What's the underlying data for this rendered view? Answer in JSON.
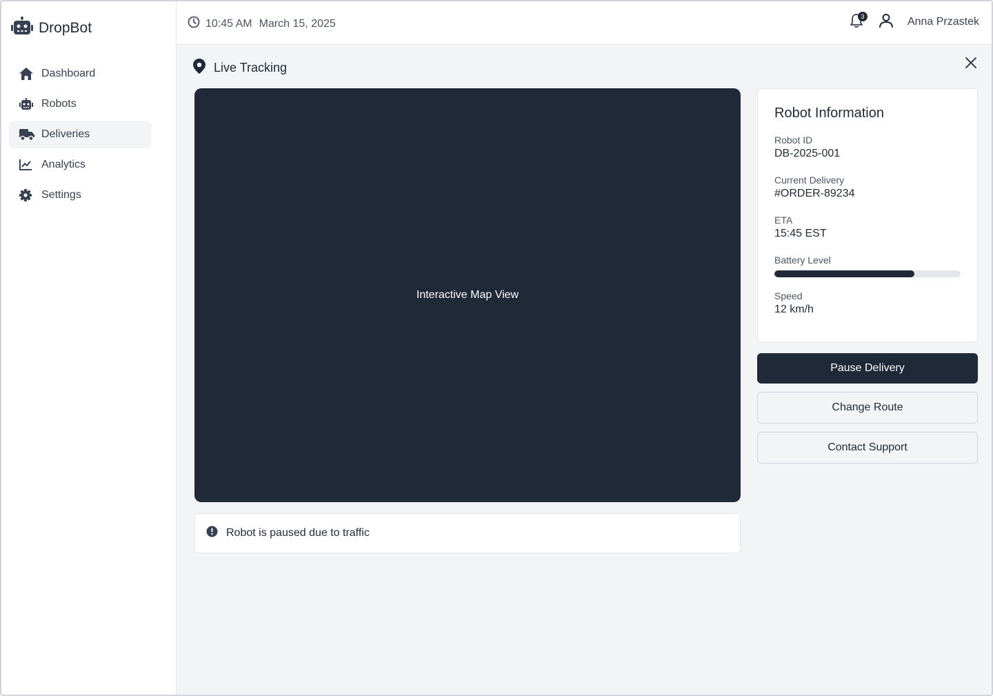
{
  "app": {
    "name": "DropBot",
    "logo_icon": "robot-icon"
  },
  "sidebar": {
    "items": [
      {
        "label": "Dashboard",
        "icon": "home-icon",
        "active": false
      },
      {
        "label": "Robots",
        "icon": "robot-icon",
        "active": false
      },
      {
        "label": "Deliveries",
        "icon": "truck-icon",
        "active": true
      },
      {
        "label": "Analytics",
        "icon": "chart-line-icon",
        "active": false
      },
      {
        "label": "Settings",
        "icon": "gear-icon",
        "active": false
      }
    ]
  },
  "header": {
    "time": "10:45 AM",
    "date": "March 15, 2025",
    "notification_count": "3",
    "user_name": "Anna Przastek"
  },
  "panel": {
    "title": "Live Tracking",
    "map_label": "Interactive Map View",
    "alert_text": "Robot is paused due to traffic"
  },
  "robot_info": {
    "title": "Robot Information",
    "robot_id_label": "Robot ID",
    "robot_id": "DB-2025-001",
    "delivery_label": "Current Delivery",
    "delivery": "#ORDER-89234",
    "eta_label": "ETA",
    "eta": "15:45 EST",
    "battery_label": "Battery Level",
    "battery_level_fraction": 0.75,
    "speed_label": "Speed",
    "speed": "12 km/h"
  },
  "actions": {
    "pause": "Pause Delivery",
    "route": "Change Route",
    "support": "Contact Support"
  },
  "colors": {
    "primary": "#1f2937",
    "background": "#f3f4f6",
    "border": "#e5e7eb"
  }
}
